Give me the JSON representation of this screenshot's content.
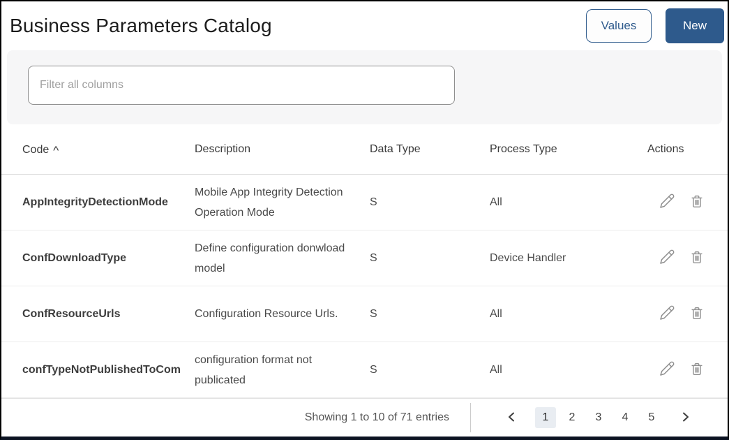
{
  "header": {
    "title": "Business Parameters Catalog",
    "values_button": "Values",
    "new_button": "New"
  },
  "filter": {
    "placeholder": "Filter all columns"
  },
  "table": {
    "columns": {
      "code": "Code",
      "sort_indicator": "^",
      "description": "Description",
      "data_type": "Data Type",
      "process_type": "Process Type",
      "actions": "Actions"
    },
    "rows": [
      {
        "code": "AppIntegrityDetectionMode",
        "description": "Mobile App Integrity Detection Operation Mode",
        "data_type": "S",
        "process_type": "All"
      },
      {
        "code": "ConfDownloadType",
        "description": "Define configuration donwload model",
        "data_type": "S",
        "process_type": "Device Handler"
      },
      {
        "code": "ConfResourceUrls",
        "description": "Configuration Resource Urls.",
        "data_type": "S",
        "process_type": "All"
      },
      {
        "code": "confTypeNotPublishedToCom",
        "description": "configuration format not publicated",
        "data_type": "S",
        "process_type": "All"
      }
    ]
  },
  "footer": {
    "showing_text": "Showing 1 to 10 of 71 entries",
    "pagination": {
      "pages": [
        "1",
        "2",
        "3",
        "4",
        "5"
      ],
      "active_page": "1"
    }
  },
  "icons": {
    "sort_ascending": "caret-up",
    "previous_page": "chevron-left",
    "next_page": "chevron-right",
    "edit": "pencil",
    "delete": "trash"
  },
  "colors": {
    "accent": "#2e5a8c",
    "active_page_bg": "#e9edf2"
  }
}
